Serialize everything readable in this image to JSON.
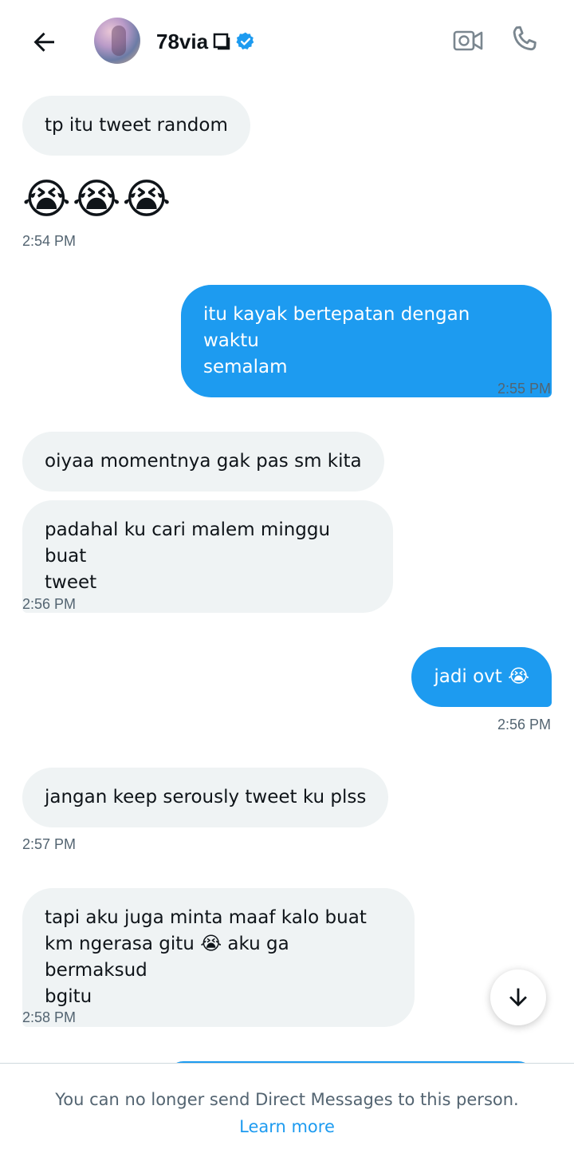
{
  "header": {
    "name": "78via",
    "back_icon": "arrow-left-icon",
    "verified_color": "#1d9bf0"
  },
  "messages": [
    {
      "text": "tp itu tweet random"
    },
    {
      "text": "😭😭😭"
    },
    {
      "time": "2:54 PM"
    },
    {
      "text": "itu kayak bertepatan dengan waktu\nsemalam"
    },
    {
      "time": "2:55 PM"
    },
    {
      "text": "oiyaa momentnya gak pas sm kita"
    },
    {
      "text": "padahal ku cari malem minggu buat\ntweet"
    },
    {
      "time": "2:56 PM"
    },
    {
      "text": "jadi ovt 😭"
    },
    {
      "time": "2:56 PM"
    },
    {
      "text": "jangan keep serously tweet ku plss"
    },
    {
      "time": "2:57 PM"
    },
    {
      "text": "tapi aku juga minta maaf kalo buat\nkm ngerasa gitu 😭 aku ga bermaksud\nbgitu"
    },
    {
      "time": "2:58 PM"
    }
  ],
  "footer": {
    "notice": "You can no longer send Direct Messages to this person.",
    "link": "Learn more"
  },
  "colors": {
    "accent": "#1d9bf0",
    "incoming_bubble": "#eff3f4",
    "muted_text": "#536471"
  }
}
